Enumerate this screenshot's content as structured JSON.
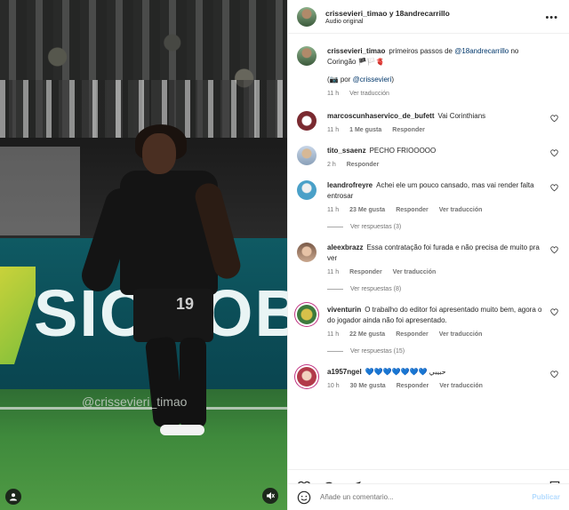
{
  "post": {
    "header_names": "crissevieri_timao y 18andrecarrillo",
    "audio": "Audio original",
    "more_icon": "more-horizontal-icon"
  },
  "media": {
    "ad_text": "SICOOB",
    "shirt_number": "19",
    "watermark": "@crissevieri_timao"
  },
  "caption": {
    "user": "crissevieri_timao",
    "text_before": "primeiros passos de",
    "mention": "@18andrecarrillo",
    "text_after": "no Coringão 🏴🏳️🫀",
    "credit_prefix": "(📷 por",
    "credit_mention": "@crissevieri",
    "credit_suffix": ")",
    "time": "11 h",
    "translate": "Ver traducción"
  },
  "comments": [
    {
      "user": "marcoscunhaservico_de_bufett",
      "text": "Vai Corinthians",
      "time": "11 h",
      "likes": "1 Me gusta",
      "reply": "Responder",
      "translate": ""
    },
    {
      "user": "tito_ssaenz",
      "text": "PECHO FRIOOOOO",
      "time": "2 h",
      "likes": "",
      "reply": "Responder",
      "translate": ""
    },
    {
      "user": "leandrofreyre",
      "text": "Achei ele um pouco cansado, mas vai render falta entrosar",
      "time": "11 h",
      "likes": "23 Me gusta",
      "reply": "Responder",
      "translate": "Ver traducción",
      "replies": "Ver respuestas (3)"
    },
    {
      "user": "aleexbrazz",
      "text": "Essa contratação foi furada e não precisa de muito pra ver",
      "time": "11 h",
      "likes": "",
      "reply": "Responder",
      "translate": "Ver traducción",
      "replies": "Ver respuestas (8)"
    },
    {
      "user": "viventurin",
      "text": "O trabalho do editor foi apresentado muito bem, agora o do jogador ainda não foi apresentado.",
      "time": "11 h",
      "likes": "22 Me gusta",
      "reply": "Responder",
      "translate": "Ver traducción",
      "replies": "Ver respuestas (15)"
    },
    {
      "user": "a1957ngel",
      "text": "💙💙💙💙💙💙💙 حبيبي",
      "time": "10 h",
      "likes": "30 Me gusta",
      "reply": "Responder",
      "translate": "Ver traducción"
    }
  ],
  "composer": {
    "placeholder": "Añade un comentario...",
    "publish": "Publicar"
  },
  "icons": [
    "heart-icon",
    "comment-icon",
    "share-icon",
    "bookmark-icon",
    "emoji-icon",
    "user-tag-icon",
    "mute-icon"
  ]
}
